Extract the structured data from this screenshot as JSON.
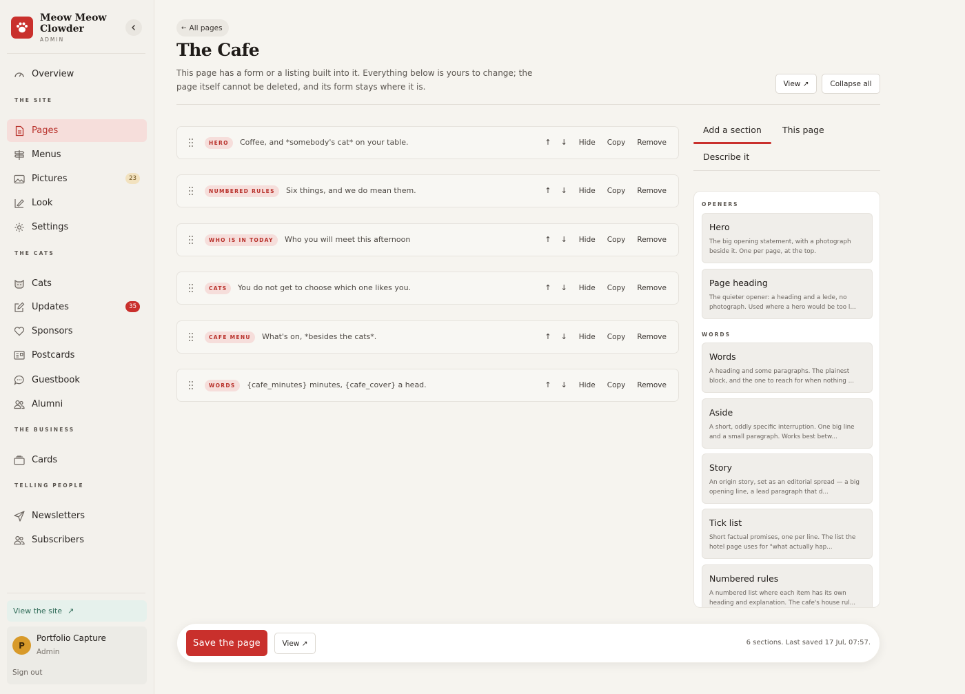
{
  "brand": {
    "name": "Meow Meow Clowder",
    "subtitle": "ADMIN"
  },
  "sidebar": {
    "overview": "Overview",
    "sections": {
      "site": "THE SITE",
      "cats": "THE CATS",
      "business": "THE BUSINESS",
      "telling": "TELLING PEOPLE"
    },
    "items": {
      "pages": "Pages",
      "menus": "Menus",
      "pictures": "Pictures",
      "pictures_count": "23",
      "look": "Look",
      "settings": "Settings",
      "cats": "Cats",
      "updates": "Updates",
      "updates_count": "35",
      "sponsors": "Sponsors",
      "postcards": "Postcards",
      "guestbook": "Guestbook",
      "alumni": "Alumni",
      "cards": "Cards",
      "newsletters": "Newsletters",
      "subscribers": "Subscribers"
    },
    "view_site": "View the site",
    "user": {
      "initial": "P",
      "name": "Portfolio Capture",
      "role": "Admin",
      "sign_out": "Sign out"
    }
  },
  "header": {
    "back": "All pages",
    "title": "The Cafe",
    "description": "This page has a form or a listing built into it. Everything below is yours to change; the page itself cannot be deleted, and its form stays where it is.",
    "view_label": "View ↗",
    "collapse_label": "Collapse all"
  },
  "row_actions": {
    "up": "↑",
    "down": "↓",
    "hide": "Hide",
    "copy": "Copy",
    "remove": "Remove"
  },
  "sections": [
    {
      "tag": "HERO",
      "text": "Coffee, and *somebody's cat* on your table."
    },
    {
      "tag": "NUMBERED RULES",
      "text": "Six things, and we do mean them."
    },
    {
      "tag": "WHO IS IN TODAY",
      "text": "Who you will meet this afternoon"
    },
    {
      "tag": "CATS",
      "text": "You do not get to choose which one likes you."
    },
    {
      "tag": "CAFE MENU",
      "text": "What's on, *besides the cats*."
    },
    {
      "tag": "WORDS",
      "text": "{cafe_minutes} minutes, {cafe_cover} a head."
    }
  ],
  "panel": {
    "tabs": {
      "add": "Add a section",
      "this_page": "This page",
      "describe": "Describe it"
    },
    "groups": {
      "openers": "OPENERS",
      "words": "WORDS"
    },
    "cards": [
      {
        "title": "Hero",
        "desc": "The big opening statement, with a photograph beside it. One per page, at the top."
      },
      {
        "title": "Page heading",
        "desc": "The quieter opener: a heading and a lede, no photograph. Used where a hero would be too l..."
      },
      {
        "title": "Words",
        "desc": "A heading and some paragraphs. The plainest block, and the one to reach for when nothing ..."
      },
      {
        "title": "Aside",
        "desc": "A short, oddly specific interruption. One big line and a small paragraph. Works best betw..."
      },
      {
        "title": "Story",
        "desc": "An origin story, set as an editorial spread — a big opening line, a lead paragraph that d..."
      },
      {
        "title": "Tick list",
        "desc": "Short factual promises, one per line. The list the hotel page uses for \"what actually hap..."
      },
      {
        "title": "Numbered rules",
        "desc": "A numbered list where each item has its own heading and explanation. The cafe's house rul..."
      }
    ]
  },
  "save_bar": {
    "save_label": "Save the page",
    "view_label": "View ↗",
    "status": "6 sections. Last saved 17 Jul, 07:57."
  },
  "colors": {
    "accent": "#c9302c",
    "accent_soft": "#f6dedb",
    "success_soft": "#e6f1ec"
  }
}
